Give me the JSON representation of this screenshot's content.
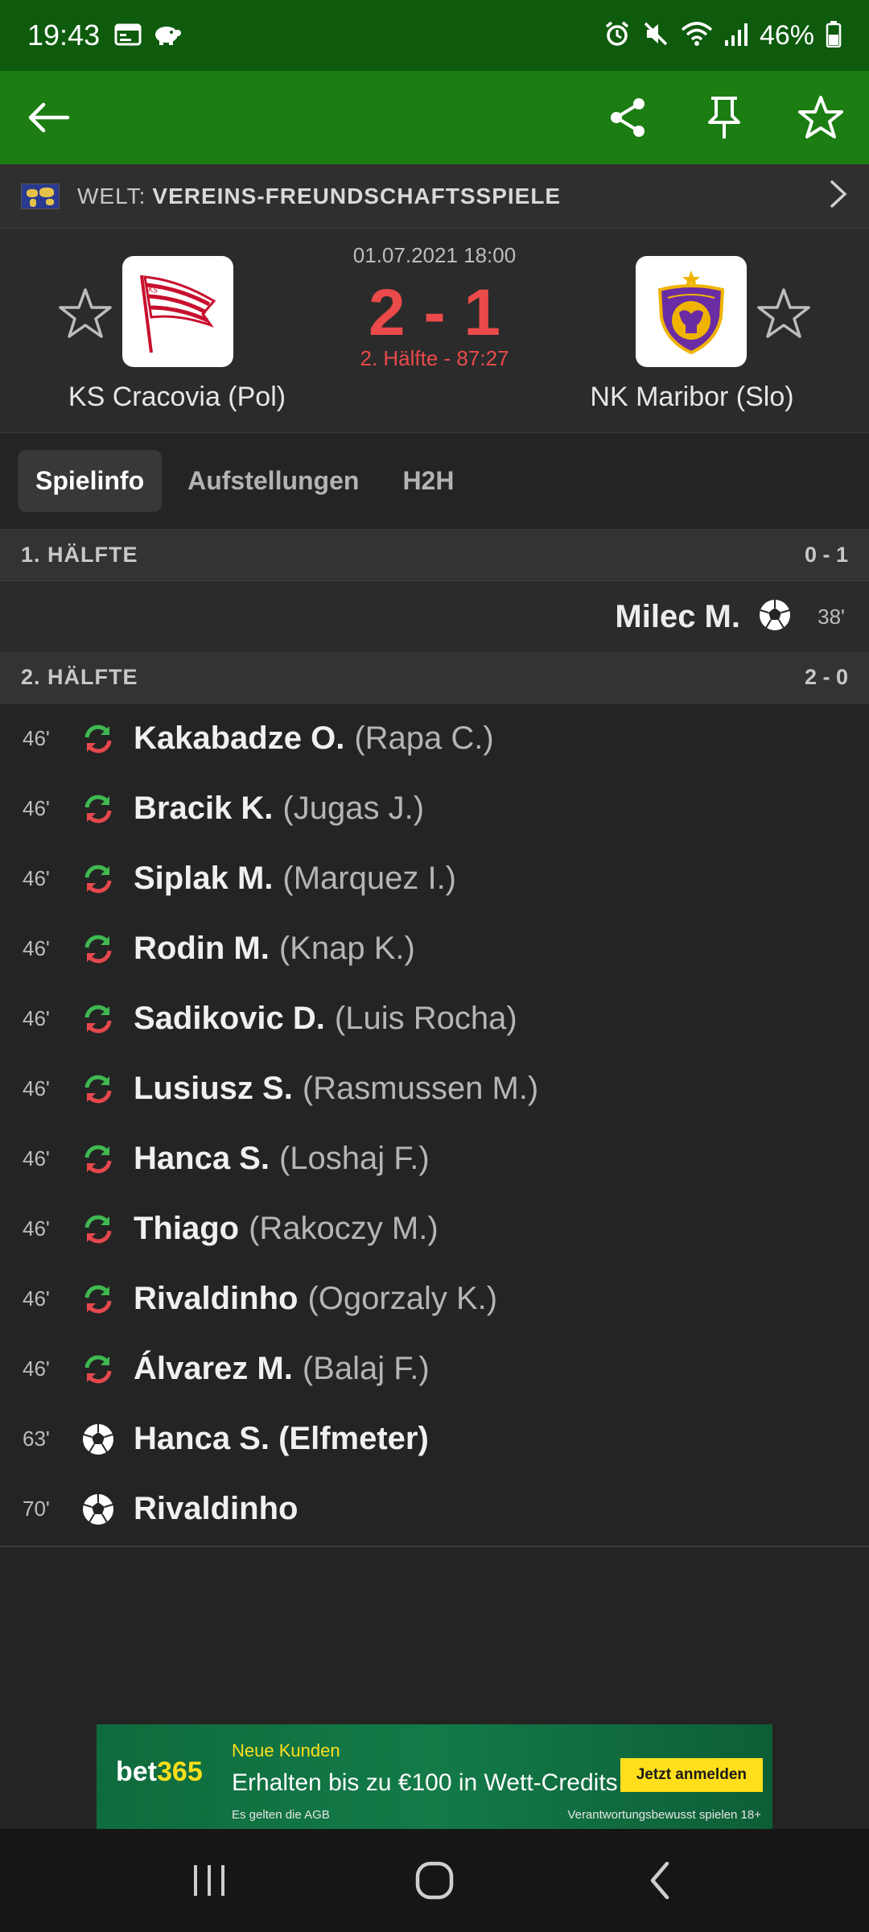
{
  "status_bar": {
    "time": "19:43",
    "battery": "46%",
    "icons": [
      "calendar-icon",
      "piggy-bank-icon",
      "alarm-icon",
      "mute-icon",
      "wifi-icon",
      "signal-icon",
      "battery-icon"
    ]
  },
  "toolbar": {
    "icons": [
      "back-arrow-icon",
      "share-icon",
      "pin-icon",
      "star-icon"
    ]
  },
  "league": {
    "country": "WELT:",
    "name": "VEREINS-FREUNDSCHAFTSSPIELE"
  },
  "match": {
    "date": "01.07.2021 18:00",
    "score": "2 - 1",
    "status": "2. Hälfte - 87:27",
    "home": {
      "name": "KS Cracovia (Pol)",
      "logo_text": "KS CRACOVIA"
    },
    "away": {
      "name": "NK Maribor (Slo)",
      "logo_text": "NK MARIBOR 1960"
    }
  },
  "tabs": [
    {
      "label": "Spielinfo",
      "active": true
    },
    {
      "label": "Aufstellungen",
      "active": false
    },
    {
      "label": "H2H",
      "active": false
    }
  ],
  "first_half": {
    "label": "1. HÄLFTE",
    "score": "0 - 1",
    "events": [
      {
        "minute": "38'",
        "player": "Milec M.",
        "type": "goal-icon"
      }
    ]
  },
  "second_half": {
    "label": "2. HÄLFTE",
    "score": "2 - 0",
    "events": [
      {
        "minute": "46'",
        "type": "substitution-icon",
        "player": "Kakabadze O.",
        "detail": "(Rapa C.)"
      },
      {
        "minute": "46'",
        "type": "substitution-icon",
        "player": "Bracik K.",
        "detail": "(Jugas J.)"
      },
      {
        "minute": "46'",
        "type": "substitution-icon",
        "player": "Siplak M.",
        "detail": "(Marquez I.)"
      },
      {
        "minute": "46'",
        "type": "substitution-icon",
        "player": "Rodin M.",
        "detail": "(Knap K.)"
      },
      {
        "minute": "46'",
        "type": "substitution-icon",
        "player": "Sadikovic D.",
        "detail": "(Luis Rocha)"
      },
      {
        "minute": "46'",
        "type": "substitution-icon",
        "player": "Lusiusz S.",
        "detail": "(Rasmussen M.)"
      },
      {
        "minute": "46'",
        "type": "substitution-icon",
        "player": "Hanca S.",
        "detail": "(Loshaj F.)"
      },
      {
        "minute": "46'",
        "type": "substitution-icon",
        "player": "Thiago",
        "detail": "(Rakoczy M.)"
      },
      {
        "minute": "46'",
        "type": "substitution-icon",
        "player": "Rivaldinho",
        "detail": "(Ogorzaly K.)"
      },
      {
        "minute": "46'",
        "type": "substitution-icon",
        "player": "Álvarez M.",
        "detail": "(Balaj F.)"
      },
      {
        "minute": "63'",
        "type": "goal-icon",
        "player": "Hanca S. (Elfmeter)",
        "detail": ""
      },
      {
        "minute": "70'",
        "type": "goal-icon",
        "player": "Rivaldinho",
        "detail": ""
      }
    ]
  },
  "ad": {
    "brand_a": "bet",
    "brand_b": "365",
    "kicker": "Neue Kunden",
    "headline": "Erhalten bis zu €100 in Wett-Credits",
    "cta": "Jetzt anmelden",
    "terms": "Es gelten die AGB",
    "responsible": "Verantwortungsbewusst spielen 18+"
  },
  "navbar": {
    "icons": [
      "recent-apps-icon",
      "home-icon",
      "nav-back-icon"
    ]
  },
  "colors": {
    "status_bar": "#0e5b0e",
    "toolbar": "#1c7d13",
    "score_red": "#ea4a4a",
    "sub_green": "#3fb950",
    "sub_red": "#e5484d",
    "background": "#242424"
  }
}
